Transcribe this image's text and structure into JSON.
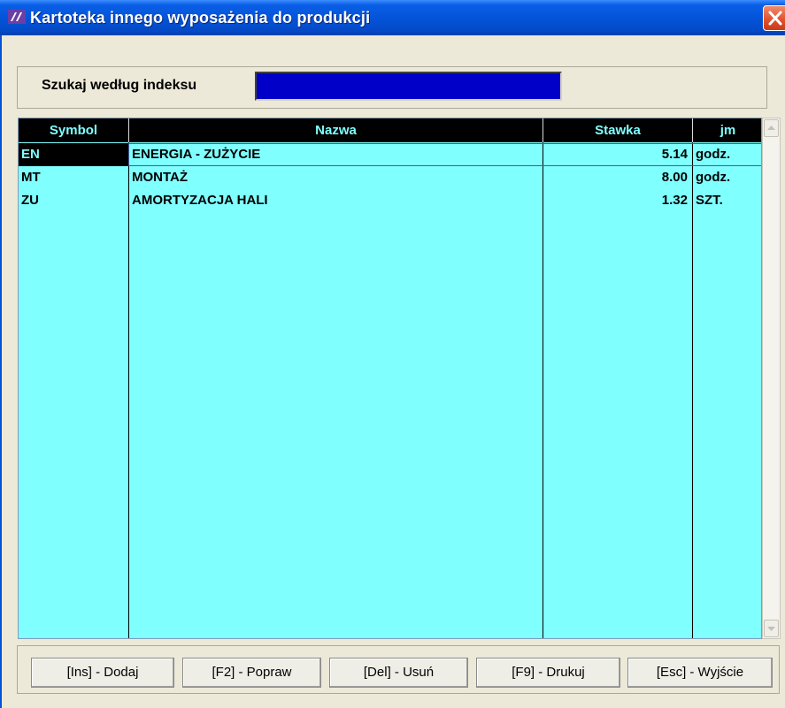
{
  "window": {
    "title": "Kartoteka  innego wyposażenia do produkcji",
    "app_icon": "app-logo-icon",
    "close_icon": "close-icon"
  },
  "search": {
    "label": "Szukaj według indeksu",
    "value": ""
  },
  "table": {
    "columns": [
      "Symbol",
      "Nazwa",
      "Stawka",
      "jm"
    ],
    "rows": [
      {
        "symbol": "EN",
        "nazwa": "ENERGIA - ZUŻYCIE",
        "stawka": "5.14",
        "jm": "godz."
      },
      {
        "symbol": "MT",
        "nazwa": "MONTAŻ",
        "stawka": "8.00",
        "jm": "godz."
      },
      {
        "symbol": "ZU",
        "nazwa": "AMORTYZACJA HALI",
        "stawka": "1.32",
        "jm": "SZT."
      }
    ],
    "selected_row": 0
  },
  "buttons": {
    "add": "[Ins] - Dodaj",
    "edit": "[F2] - Popraw",
    "delete": "[Del] - Usuń",
    "print": "[F9] - Drukuj",
    "exit": "[Esc] - Wyjście"
  },
  "colors": {
    "grid_bg": "#80ffff",
    "header_bg": "#000000",
    "search_bg": "#0000c8",
    "titlebar": "#0452d8"
  }
}
